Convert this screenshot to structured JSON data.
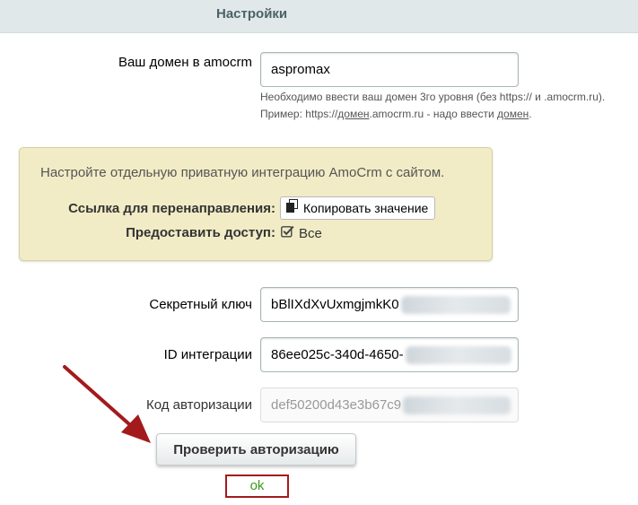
{
  "header": {
    "title": "Настройки"
  },
  "domain": {
    "label": "Ваш домен в amocrm",
    "value": "aspromax",
    "hint": {
      "line1": "Необходимо ввести ваш домен 3го уровня (без https:// и .amocrm.ru).",
      "line2_prefix": "Пример: https://",
      "line2_domain": "домен",
      "line2_middle": ".amocrm.ru - надо ввести ",
      "line2_domain2": "домен",
      "line2_suffix": "."
    }
  },
  "panel": {
    "text": "Настройте отдельную приватную интеграцию AmoCrm с сайтом.",
    "redirect_label": "Ссылка для перенаправления:",
    "copy_button": "Копировать значение",
    "access_label": "Предоставить доступ:",
    "access_value": "Все",
    "access_checked": true
  },
  "fields": {
    "secret": {
      "label": "Секретный ключ",
      "value": "bBlIXdXvUxmgjmkK0"
    },
    "integration_id": {
      "label": "ID интеграции",
      "value": "86ee025c-340d-4650-"
    },
    "auth_code": {
      "label": "Код авторизации",
      "value": "def50200d43e3b67c9"
    }
  },
  "check_button": "Проверить авторизацию",
  "status": "ok",
  "colors": {
    "header_bg": "#e0e8ea",
    "panel_bg": "#f1ecc6",
    "status_text": "#3a9a1c",
    "annotation_red": "#a31a1c"
  },
  "icons": {
    "copy": "copy-icon",
    "checkbox": "checkbox-checked-icon",
    "annotation_arrow": "arrow-annotation-icon"
  }
}
